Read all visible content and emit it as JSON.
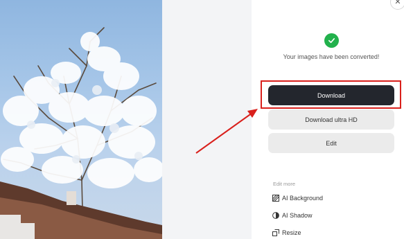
{
  "preview": {
    "alt": "Blossoming white tree against blue sky over tiled rooftop"
  },
  "status": {
    "message": "Your images have been converted!"
  },
  "actions": {
    "download_label": "Download",
    "download_uhd_label": "Download ultra HD",
    "edit_label": "Edit"
  },
  "edit_more": {
    "title": "Edit more",
    "items": [
      {
        "label": "AI Background",
        "icon": "ai-background-icon"
      },
      {
        "label": "AI Shadow",
        "icon": "ai-shadow-icon"
      },
      {
        "label": "Resize",
        "icon": "resize-icon"
      }
    ]
  },
  "colors": {
    "primary_button": "#23262d",
    "secondary_button": "#ebebeb",
    "success": "#22b14c",
    "annotation": "#d9201c"
  }
}
